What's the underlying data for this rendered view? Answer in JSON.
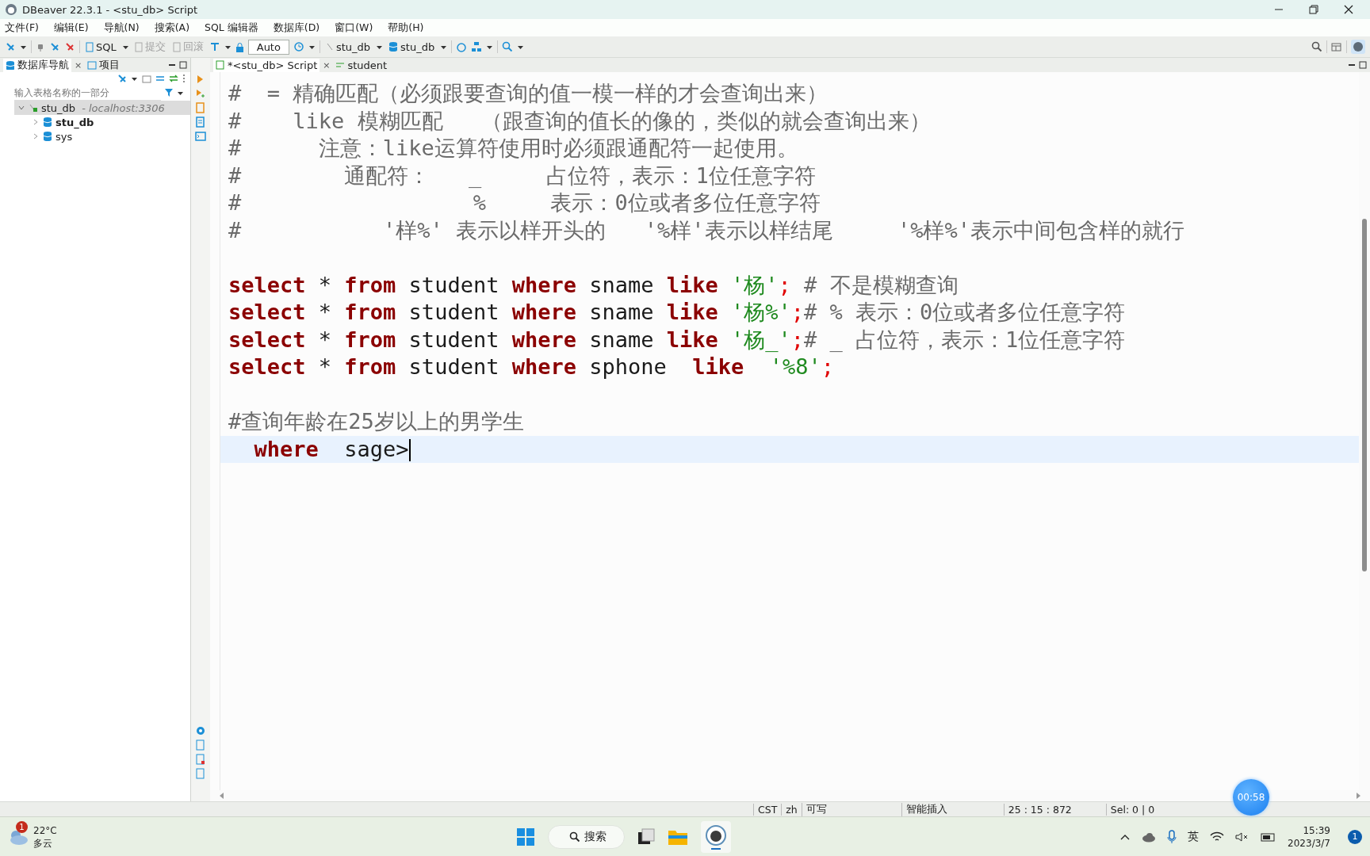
{
  "window": {
    "title": "DBeaver 22.3.1 - <stu_db> Script"
  },
  "menu": [
    "文件(F)",
    "编辑(E)",
    "导航(N)",
    "搜索(A)",
    "SQL 编辑器",
    "数据库(D)",
    "窗口(W)",
    "帮助(H)"
  ],
  "toolbar": {
    "sql": "SQL",
    "commit": {
      "label": "提交",
      "disabled": true
    },
    "rollback": {
      "label": "回滚",
      "disabled": true
    },
    "mode": "Auto",
    "datasource": "stu_db",
    "schema": "stu_db"
  },
  "navigator": {
    "tabs": [
      {
        "label": "数据库导航",
        "selected": true,
        "close": "×"
      },
      {
        "label": "项目",
        "selected": false
      }
    ],
    "filter": {
      "placeholder": "输入表格名称的一部分"
    },
    "tree": [
      {
        "label": "stu_db",
        "note": "- localhost:3306",
        "expanded": true,
        "selected": true,
        "children": [
          {
            "label": "stu_db",
            "bold": true,
            "expanded": false,
            "selected": false
          },
          {
            "label": "sys",
            "bold": false,
            "expanded": false,
            "selected": false
          }
        ]
      }
    ]
  },
  "editor": {
    "tabs": [
      {
        "label": "*<stu_db> Script",
        "selected": true,
        "close": "×"
      },
      {
        "label": "student",
        "selected": false
      }
    ],
    "lines": [
      {
        "kind": "comment",
        "text": "#  = 精确匹配（必须跟要查询的值一模一样的才会查询出来）"
      },
      {
        "kind": "comment",
        "text": "#    like 模糊匹配   （跟查询的值长的像的，类似的就会查询出来）"
      },
      {
        "kind": "comment",
        "text": "#      注意：like运算符使用时必须跟通配符一起使用。"
      },
      {
        "kind": "comment",
        "text": "#        通配符：   _     占位符，表示：1位任意字符"
      },
      {
        "kind": "comment",
        "text": "#                  %     表示：0位或者多位任意字符"
      },
      {
        "kind": "comment",
        "text": "#           '样%' 表示以样开头的   '%样'表示以样结尾     '%样%'表示中间包含样的就行"
      },
      {
        "kind": "blank"
      },
      {
        "kind": "code",
        "tokens": [
          {
            "kind": "keyword",
            "text": "select"
          },
          {
            "kind": "plain",
            "text": " * "
          },
          {
            "kind": "keyword",
            "text": "from"
          },
          {
            "kind": "plain",
            "text": " student "
          },
          {
            "kind": "keyword",
            "text": "where"
          },
          {
            "kind": "plain",
            "text": " sname "
          },
          {
            "kind": "keyword",
            "text": "like "
          },
          {
            "kind": "string",
            "text": "'杨'"
          },
          {
            "kind": "punct",
            "text": ";"
          },
          {
            "kind": "comment",
            "text": " # 不是模糊查询"
          }
        ]
      },
      {
        "kind": "code",
        "tokens": [
          {
            "kind": "keyword",
            "text": "select"
          },
          {
            "kind": "plain",
            "text": " * "
          },
          {
            "kind": "keyword",
            "text": "from"
          },
          {
            "kind": "plain",
            "text": " student "
          },
          {
            "kind": "keyword",
            "text": "where"
          },
          {
            "kind": "plain",
            "text": " sname "
          },
          {
            "kind": "keyword",
            "text": "like "
          },
          {
            "kind": "string",
            "text": "'杨%'"
          },
          {
            "kind": "punct",
            "text": ";"
          },
          {
            "kind": "comment",
            "text": "# % 表示：0位或者多位任意字符"
          }
        ]
      },
      {
        "kind": "code",
        "tokens": [
          {
            "kind": "keyword",
            "text": "select"
          },
          {
            "kind": "plain",
            "text": " * "
          },
          {
            "kind": "keyword",
            "text": "from"
          },
          {
            "kind": "plain",
            "text": " student "
          },
          {
            "kind": "keyword",
            "text": "where"
          },
          {
            "kind": "plain",
            "text": " sname "
          },
          {
            "kind": "keyword",
            "text": "like "
          },
          {
            "kind": "string",
            "text": "'杨_'"
          },
          {
            "kind": "punct",
            "text": ";"
          },
          {
            "kind": "comment",
            "text": "# _ 占位符，表示：1位任意字符"
          }
        ]
      },
      {
        "kind": "code",
        "tokens": [
          {
            "kind": "keyword",
            "text": "select"
          },
          {
            "kind": "plain",
            "text": " * "
          },
          {
            "kind": "keyword",
            "text": "from"
          },
          {
            "kind": "plain",
            "text": " student "
          },
          {
            "kind": "keyword",
            "text": "where"
          },
          {
            "kind": "plain",
            "text": " sphone  "
          },
          {
            "kind": "keyword",
            "text": "like  "
          },
          {
            "kind": "string",
            "text": "'%8'"
          },
          {
            "kind": "punct",
            "text": ";"
          }
        ]
      },
      {
        "kind": "blank"
      },
      {
        "kind": "comment",
        "text": "#查询年龄在25岁以上的男学生"
      },
      {
        "kind": "code",
        "current": true,
        "tokens": [
          {
            "kind": "keyword",
            "text": "  where"
          },
          {
            "kind": "plain",
            "text": "  sage>"
          }
        ]
      }
    ]
  },
  "status_bar": {
    "timezone": "CST",
    "locale": "zh",
    "access": "可写",
    "insert_mode": "智能插入",
    "position": "25 : 15 : 872",
    "selection": "Sel: 0 | 0"
  },
  "recorder": {
    "timer": "00:58"
  },
  "taskbar": {
    "weather": {
      "temp": "22°C",
      "condition": "多云",
      "badge": "1"
    },
    "search": "搜索",
    "ime": "英",
    "time": "15:39",
    "date": "2023/3/7",
    "notifications": "1"
  }
}
